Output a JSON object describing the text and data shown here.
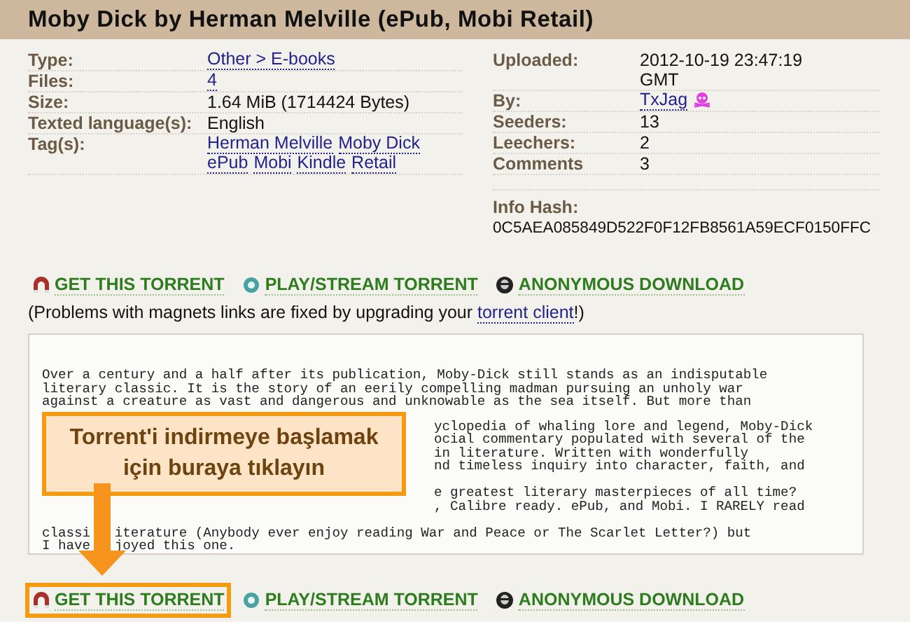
{
  "title": "Moby Dick by Herman Melville (ePub, Mobi Retail)",
  "details_left": [
    {
      "label": "Type:",
      "kind": "links",
      "values": [
        "Other > E-books"
      ]
    },
    {
      "label": "Files:",
      "kind": "links",
      "values": [
        "4"
      ]
    },
    {
      "label": "Size:",
      "kind": "text",
      "values": [
        "1.64 MiB (1714424 Bytes)"
      ]
    },
    {
      "label": "Texted language(s):",
      "kind": "text",
      "values": [
        "English"
      ]
    },
    {
      "label": "Tag(s):",
      "kind": "links",
      "values": [
        "Herman Melville",
        "Moby Dick",
        "ePub",
        "Mobi",
        "Kindle",
        "Retail"
      ]
    }
  ],
  "details_right": [
    {
      "label": "Uploaded:",
      "kind": "text",
      "values": [
        "2012-10-19 23:47:19 GMT"
      ]
    },
    {
      "label": "By:",
      "kind": "user",
      "values": [
        "TxJag"
      ],
      "trusted": true
    },
    {
      "label": "Seeders:",
      "kind": "text",
      "values": [
        "13"
      ]
    },
    {
      "label": "Leechers:",
      "kind": "text",
      "values": [
        "2"
      ]
    },
    {
      "label": "Comments",
      "kind": "text",
      "values": [
        "3"
      ]
    }
  ],
  "info_hash": {
    "label": "Info Hash:",
    "value": "0C5AEA085849D522F0F12FB8561A59ECF0150FFC"
  },
  "top_links": [
    {
      "kind": "magnet",
      "label": "GET THIS TORRENT",
      "highlighted": false
    },
    {
      "kind": "stream",
      "label": "PLAY/STREAM TORRENT",
      "highlighted": false
    },
    {
      "kind": "anonymous",
      "label": "ANONYMOUS DOWNLOAD",
      "highlighted": false
    }
  ],
  "note": {
    "before": "(Problems with magnets links are fixed by upgrading your ",
    "link": "torrent client",
    "after": "!)"
  },
  "description": {
    "lines_top": [
      "Over a century and a half after its publication, Moby-Dick still stands as an indisputable",
      "literary classic. It is the story of an eerily compelling madman pursuing an unholy war",
      "against a creature as vast and dangerous and unknowable as the sea itself. But more than"
    ],
    "lines_beside_callout": [
      [
        "yclopedia of whaling lore and legend, Moby-Dick",
        "ocial commentary populated with several of the",
        "in literature. Written with wonderfully",
        "nd timeless inquiry into character, faith, and"
      ],
      [
        "e greatest literary masterpieces of all time?",
        ", Calibre ready. ePub, and Mobi. I RARELY read"
      ]
    ],
    "lines_bottom": [
      [
        "classi",
        "iterature (Anybody ever enjoy reading War and Peace or The Scarlet Letter?) but"
      ],
      [
        "I have",
        "joyed this one."
      ]
    ]
  },
  "callout": "Torrent'i indirmeye başlamak için buraya tıklayın",
  "bottom_links": [
    {
      "kind": "magnet",
      "label": "GET THIS TORRENT",
      "highlighted": true
    },
    {
      "kind": "stream",
      "label": "PLAY/STREAM TORRENT",
      "highlighted": false
    },
    {
      "kind": "anonymous",
      "label": "ANONYMOUS DOWNLOAD",
      "highlighted": false
    }
  ]
}
